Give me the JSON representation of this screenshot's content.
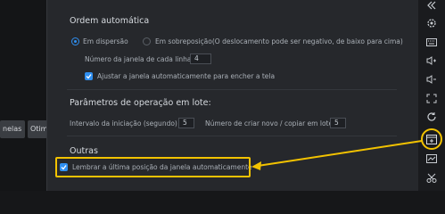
{
  "background_buttons": {
    "janelas": "nelas",
    "otim": "Otim"
  },
  "ordem": {
    "title": "Ordem automática",
    "radio_dispersao": "Em dispersão",
    "radio_sobreposicao": "Em sobreposição(O deslocamento pode ser negativo, de baixo para cima)",
    "num_janela_label": "Número da janela de cada linha",
    "num_janela_value": "4",
    "ajustar_label": "Ajustar a janela automaticamente para encher a tela",
    "selected_mode": "Em dispersão",
    "ajustar_checked": true
  },
  "parametros": {
    "title": "Parâmetros de operação em lote:",
    "intervalo_label": "Intervalo da iniciação (segundo)",
    "intervalo_value": "5",
    "criar_label": "Número de criar novo / copiar em lote",
    "criar_value": "5"
  },
  "outras": {
    "title": "Outras",
    "lembrar_label": "Lembrar a última posição da janela automaticamente",
    "lembrar_checked": true
  },
  "toolbar": {
    "icons": [
      "collapse-icon",
      "settings-icon",
      "keyboard-icon",
      "volume-up-icon",
      "volume-down-icon",
      "fullscreen-icon",
      "rotate-icon",
      "window-add-icon",
      "screenshot-icon",
      "cut-icon"
    ],
    "highlighted_icon": "window-add-icon"
  },
  "colors": {
    "accent": "#2f8ff0",
    "highlight": "#f2c200",
    "panel_bg": "#26282c"
  }
}
